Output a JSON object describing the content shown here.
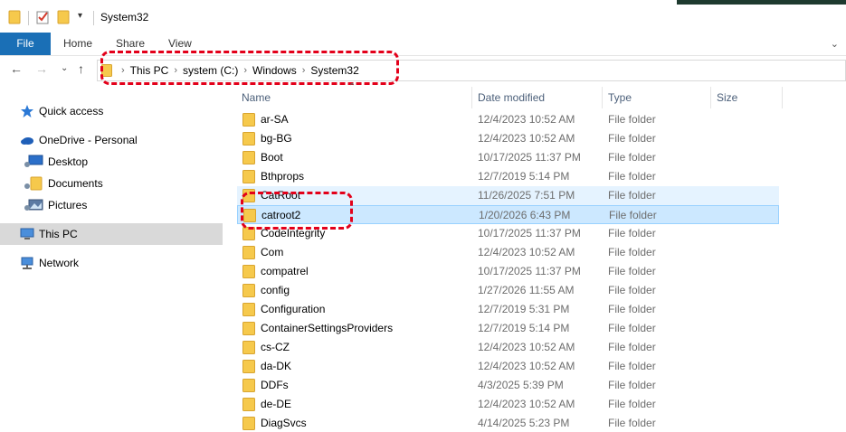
{
  "window": {
    "title": "System32"
  },
  "ribbon": {
    "tabs": [
      "File",
      "Home",
      "Share",
      "View"
    ]
  },
  "address": {
    "crumbs": [
      "This PC",
      "system (C:)",
      "Windows",
      "System32"
    ]
  },
  "nav": {
    "items": [
      {
        "label": "Quick access",
        "icon": "star-icon"
      },
      {
        "label": "OneDrive - Personal",
        "icon": "cloud-icon"
      },
      {
        "label": "Desktop",
        "icon": "desktop-icon"
      },
      {
        "label": "Documents",
        "icon": "documents-icon"
      },
      {
        "label": "Pictures",
        "icon": "pictures-icon"
      },
      {
        "label": "This PC",
        "icon": "computer-icon",
        "selected": true
      },
      {
        "label": "Network",
        "icon": "network-icon"
      }
    ]
  },
  "columns": {
    "name": "Name",
    "date": "Date modified",
    "type": "Type",
    "size": "Size"
  },
  "files": [
    {
      "name": "ar-SA",
      "date": "12/4/2023 10:52 AM",
      "type": "File folder"
    },
    {
      "name": "bg-BG",
      "date": "12/4/2023 10:52 AM",
      "type": "File folder"
    },
    {
      "name": "Boot",
      "date": "10/17/2025 11:37 PM",
      "type": "File folder"
    },
    {
      "name": "Bthprops",
      "date": "12/7/2019 5:14 PM",
      "type": "File folder"
    },
    {
      "name": "CatRoot",
      "date": "11/26/2025 7:51 PM",
      "type": "File folder"
    },
    {
      "name": "catroot2",
      "date": "1/20/2026 6:43 PM",
      "type": "File folder"
    },
    {
      "name": "CodeIntegrity",
      "date": "10/17/2025 11:37 PM",
      "type": "File folder"
    },
    {
      "name": "Com",
      "date": "12/4/2023 10:52 AM",
      "type": "File folder"
    },
    {
      "name": "compatrel",
      "date": "10/17/2025 11:37 PM",
      "type": "File folder"
    },
    {
      "name": "config",
      "date": "1/27/2026 11:55 AM",
      "type": "File folder"
    },
    {
      "name": "Configuration",
      "date": "12/7/2019 5:31 PM",
      "type": "File folder"
    },
    {
      "name": "ContainerSettingsProviders",
      "date": "12/7/2019 5:14 PM",
      "type": "File folder"
    },
    {
      "name": "cs-CZ",
      "date": "12/4/2023 10:52 AM",
      "type": "File folder"
    },
    {
      "name": "da-DK",
      "date": "12/4/2023 10:52 AM",
      "type": "File folder"
    },
    {
      "name": "DDFs",
      "date": "4/3/2025 5:39 PM",
      "type": "File folder"
    },
    {
      "name": "de-DE",
      "date": "12/4/2023 10:52 AM",
      "type": "File folder"
    },
    {
      "name": "DiagSvcs",
      "date": "4/14/2025 5:23 PM",
      "type": "File folder"
    }
  ],
  "colors": {
    "accent": "#1a6fb6",
    "highlight": "#e3001a",
    "selection": "#cce8ff",
    "hover": "#e5f3ff"
  }
}
